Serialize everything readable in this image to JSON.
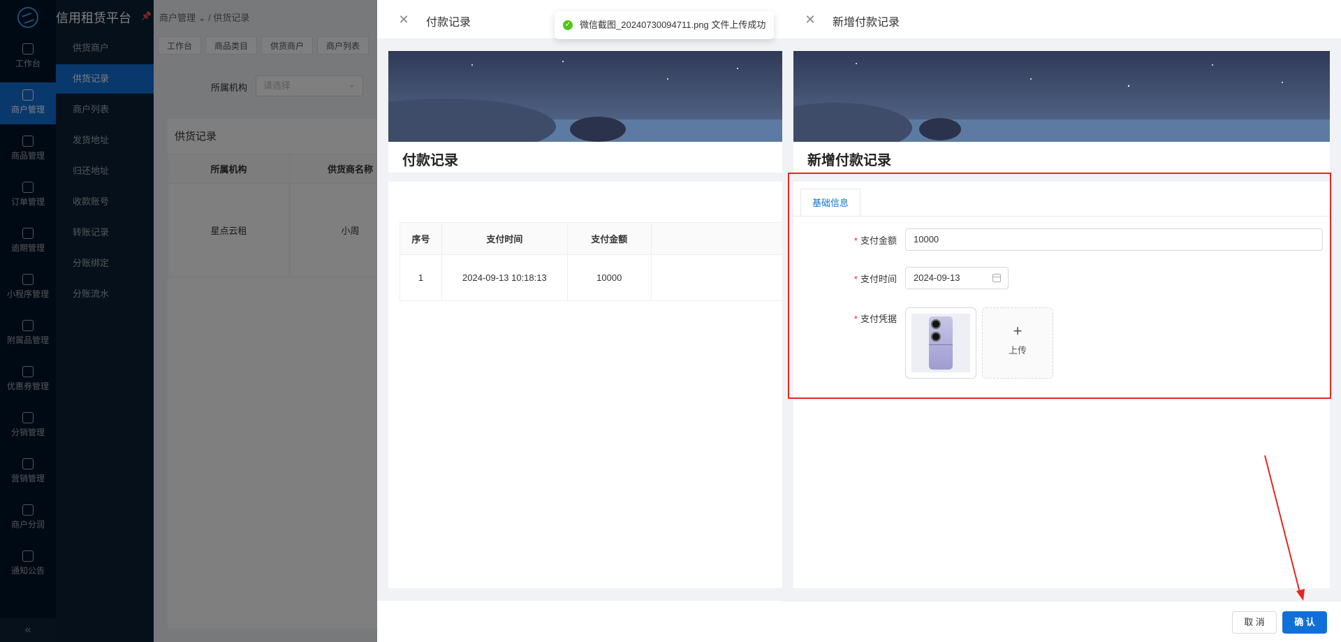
{
  "app": {
    "brand": "信用租赁平台",
    "rail": [
      {
        "label": "工作台",
        "icon": "home-icon"
      },
      {
        "label": "商户管理",
        "icon": "shop-icon",
        "active": true
      },
      {
        "label": "商品管理",
        "icon": "apple-icon"
      },
      {
        "label": "订单管理",
        "icon": "trophy-icon"
      },
      {
        "label": "逾期管理",
        "icon": "alarm-icon"
      },
      {
        "label": "小程序管理",
        "icon": "watch-icon"
      },
      {
        "label": "附属品管理",
        "icon": "cart-icon"
      },
      {
        "label": "优惠券管理",
        "icon": "gift-icon"
      },
      {
        "label": "分销管理",
        "icon": "chart-icon"
      },
      {
        "label": "营销管理",
        "icon": "megaphone-icon"
      },
      {
        "label": "商户分润",
        "icon": "yen-icon"
      },
      {
        "label": "通知公告",
        "icon": "announce-icon"
      }
    ],
    "submenu": [
      "供货商户",
      "供货记录",
      "商户列表",
      "发货地址",
      "归还地址",
      "收款账号",
      "转账记录",
      "分账绑定",
      "分账流水"
    ],
    "breadcrumb": [
      "商户管理",
      "供货记录"
    ],
    "tabs": [
      "工作台",
      "商品类目",
      "供货商户",
      "商户列表"
    ],
    "filter": {
      "label": "所属机构",
      "placeholder": "请选择"
    },
    "section_title": "供货记录",
    "table": {
      "headers": [
        "所属机构",
        "供货商名称"
      ],
      "row": [
        "星点云租",
        "小周"
      ]
    }
  },
  "pay_drawer": {
    "title": "付款记录",
    "banner_title": "付款记录",
    "table": {
      "headers": [
        "序号",
        "支付时间",
        "支付金额"
      ],
      "rows": [
        [
          "1",
          "2024-09-13 10:18:13",
          "10000"
        ]
      ]
    }
  },
  "new_drawer": {
    "title": "新增付款记录",
    "banner_title": "新增付款记录",
    "tab": "基础信息",
    "fields": {
      "amount_label": "支付金额",
      "amount_value": "10000",
      "time_label": "支付时间",
      "time_value": "2024-09-13",
      "proof_label": "支付凭据",
      "upload_label": "上传"
    },
    "cancel": "取 消",
    "confirm": "确 认"
  },
  "toast": {
    "message": "微信截图_20240730094711.png 文件上传成功"
  },
  "colors": {
    "primary": "#1070d8",
    "sidebar": "#001529",
    "annotation": "#e8251e",
    "success": "#52c41a"
  }
}
